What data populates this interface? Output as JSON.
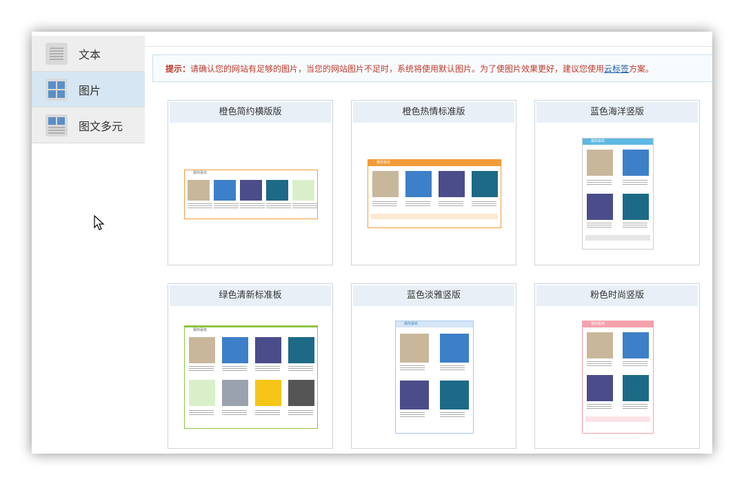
{
  "sidebar": {
    "items": [
      {
        "label": "文本",
        "icon": "text-lines-icon",
        "active": false
      },
      {
        "label": "图片",
        "icon": "image-grid-icon",
        "active": true
      },
      {
        "label": "图文多元",
        "icon": "image-text-icon",
        "active": false
      }
    ]
  },
  "tip": {
    "prefix": "提示：",
    "message": "请确认您的网站有足够的图片，当您的网站图片不足时，系统将使用默认图片。为了使图片效果更好，建议您使用",
    "link": "云标签",
    "suffix": "方案。"
  },
  "templates": [
    {
      "title": "橙色简约横版版",
      "accent": "#f29b38"
    },
    {
      "title": "橙色热情标准版",
      "accent": "#f29b38"
    },
    {
      "title": "蓝色海洋竖版",
      "accent": "#5fb9e2"
    },
    {
      "title": "绿色清新标准板",
      "accent": "#8cc63f"
    },
    {
      "title": "蓝色淡雅竖版",
      "accent": "#a9c8ea"
    },
    {
      "title": "粉色时尚竖版",
      "accent": "#f4a1ad"
    }
  ],
  "thumb_header": "猜你喜欢"
}
